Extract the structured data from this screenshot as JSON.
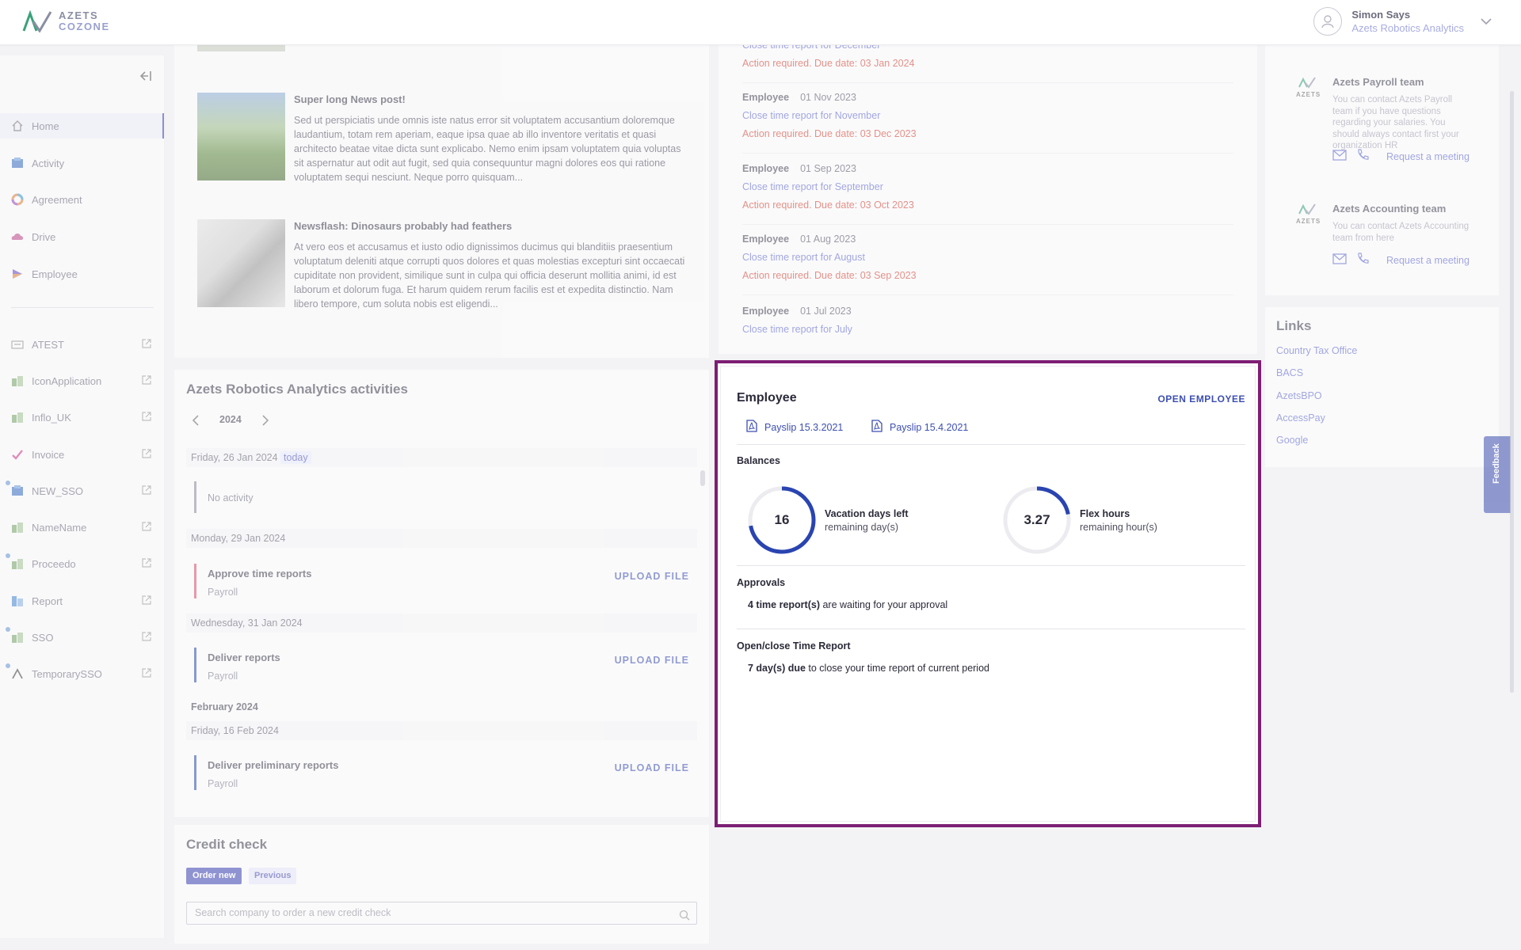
{
  "header": {
    "logo_line1": "AZETS",
    "logo_line2": "COZONE",
    "user_name": "Simon Says",
    "user_org": "Azets Robotics Analytics"
  },
  "sidebar": {
    "items": [
      {
        "label": "Home",
        "icon": "home-icon"
      },
      {
        "label": "Activity",
        "icon": "activity-icon"
      },
      {
        "label": "Agreement",
        "icon": "agreement-icon"
      },
      {
        "label": "Drive",
        "icon": "drive-icon"
      },
      {
        "label": "Employee",
        "icon": "employee-icon"
      }
    ],
    "apps": [
      {
        "label": "ATEST"
      },
      {
        "label": "IconApplication"
      },
      {
        "label": "Inflo_UK"
      },
      {
        "label": "Invoice"
      },
      {
        "label": "NEW_SSO"
      },
      {
        "label": "NameName"
      },
      {
        "label": "Proceedo"
      },
      {
        "label": "Report"
      },
      {
        "label": "SSO"
      },
      {
        "label": "TemporarySSO"
      }
    ]
  },
  "news": [
    {
      "title": "Super long News post!",
      "body": "Sed ut perspiciatis unde omnis iste natus error sit voluptatem accusantium doloremque laudantium, totam rem aperiam, eaque ipsa quae ab illo inventore veritatis et quasi architecto beatae vitae dicta sunt explicabo. Nemo enim ipsam voluptatem quia voluptas sit aspernatur aut odit aut fugit, sed quia consequuntur magni dolores eos qui ratione voluptatem sequi nesciunt. Neque porro quisquam..."
    },
    {
      "title": "Newsflash: Dinosaurs probably had feathers",
      "body": "At vero eos et accusamus et iusto odio dignissimos ducimus qui blanditiis praesentium voluptatum deleniti atque corrupti quos dolores et quas molestias excepturi sint occaecati cupiditate non provident, similique sunt in culpa qui officia deserunt mollitia animi, id est laborum et dolorum fuga. Et harum quidem rerum facilis est et expedita distinctio. Nam libero tempore, cum soluta nobis est eligendi..."
    }
  ],
  "tasks": {
    "top_link": "Close time report for December",
    "top_warn": "Action required. Due date: 03 Jan 2024",
    "items": [
      {
        "who": "Employee",
        "date": "01 Nov 2023",
        "link": "Close time report for November",
        "warn": "Action required. Due date: 03 Dec 2023"
      },
      {
        "who": "Employee",
        "date": "01 Sep 2023",
        "link": "Close time report for September",
        "warn": "Action required. Due date: 03 Oct 2023"
      },
      {
        "who": "Employee",
        "date": "01 Aug 2023",
        "link": "Close time report for August",
        "warn": "Action required. Due date: 03 Sep 2023"
      },
      {
        "who": "Employee",
        "date": "01 Jul 2023",
        "link": "Close time report for July",
        "warn": ""
      }
    ]
  },
  "activities": {
    "title": "Azets Robotics Analytics activities",
    "year": "2024",
    "day1": "Friday, 26 Jan 2024",
    "today": "today",
    "no_activity": "No activity",
    "day2": "Monday, 29 Jan 2024",
    "item1_title": "Approve time reports",
    "item1_sub": "Payroll",
    "day3": "Wednesday, 31 Jan 2024",
    "item2_title": "Deliver reports",
    "item2_sub": "Payroll",
    "month": "February 2024",
    "day4": "Friday, 16 Feb 2024",
    "item3_title": "Deliver preliminary reports",
    "item3_sub": "Payroll",
    "upload": "UPLOAD FILE"
  },
  "credit": {
    "title": "Credit check",
    "order_new": "Order new",
    "previous": "Previous",
    "placeholder": "Search company to order a new credit check"
  },
  "contacts": [
    {
      "title": "Azets Payroll team",
      "body": "You can contact Azets Payroll team if you have questions regarding your salaries. You should always contact first your organization HR",
      "request": "Request a meeting"
    },
    {
      "title": "Azets Accounting team",
      "body": "You can contact Azets Accounting team from here",
      "request": "Request a meeting"
    }
  ],
  "links": {
    "title": "Links",
    "items": [
      "Country Tax Office",
      "BACS",
      "AzetsBPO",
      "AccessPay",
      "Google"
    ]
  },
  "feedback": "Feedback",
  "employee": {
    "title": "Employee",
    "open": "OPEN EMPLOYEE",
    "payslips": [
      "Payslip 15.3.2021",
      "Payslip 15.4.2021"
    ],
    "balances_title": "Balances",
    "vacation": {
      "value": "16",
      "label": "Vacation days left",
      "sub": "remaining day(s)",
      "fill_fraction": 0.72
    },
    "flex": {
      "value": "3.27",
      "label": "Flex hours",
      "sub": "remaining hour(s)",
      "fill_fraction": 0.22
    },
    "approvals_title": "Approvals",
    "approvals_bold": "4 time report(s)",
    "approvals_rest": " are waiting for your approval",
    "timereport_title": "Open/close Time Report",
    "timereport_bold": "7 day(s) due",
    "timereport_rest": " to close your time report of current period"
  },
  "colors": {
    "accent": "#3d4fb0",
    "highlight": "#7d1e74",
    "warning": "#d23a2a"
  }
}
